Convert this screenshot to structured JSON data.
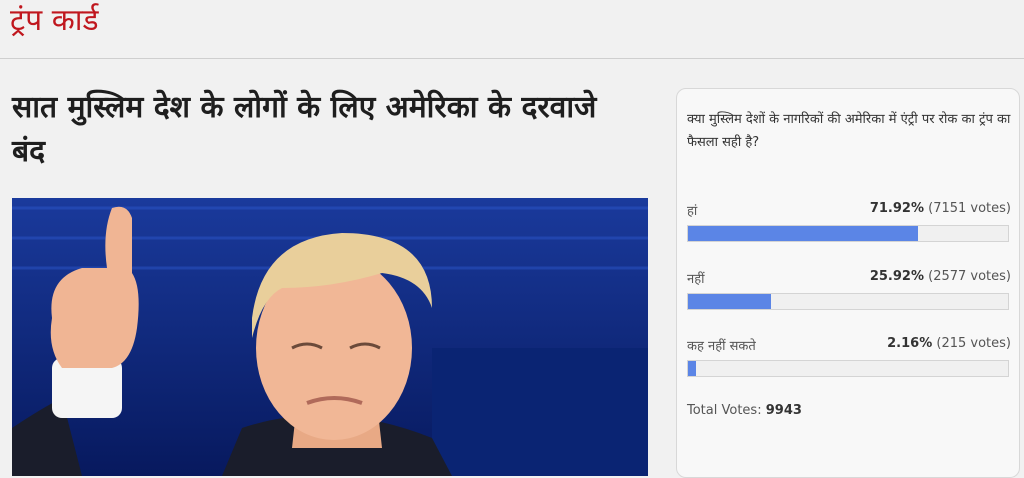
{
  "section": {
    "title": "ट्रंप कार्ड"
  },
  "article": {
    "headline": "सात मुस्लिम देश के लोगों के लिए अमेरिका के दरवाजे बंद"
  },
  "poll": {
    "question": "क्या मुस्लिम देशों के नागरिकों की अमेरिका में एंट्री पर रोक का ट्रंप का फैसला सही है?",
    "options": [
      {
        "label": "हां",
        "percent": "71.92%",
        "votes": "(7151 votes)",
        "fraction": 0.7192
      },
      {
        "label": "नहीं",
        "percent": "25.92%",
        "votes": "(2577 votes)",
        "fraction": 0.2592
      },
      {
        "label": "कह नहीं सकते",
        "percent": "2.16%",
        "votes": "(215 votes)",
        "fraction": 0.0216
      }
    ],
    "total_label": "Total Votes:",
    "total_value": "9943",
    "bar_color": "#5b85e6"
  },
  "colors": {
    "brand_red": "#c0171e",
    "stage_blue": "#0c2a85"
  }
}
